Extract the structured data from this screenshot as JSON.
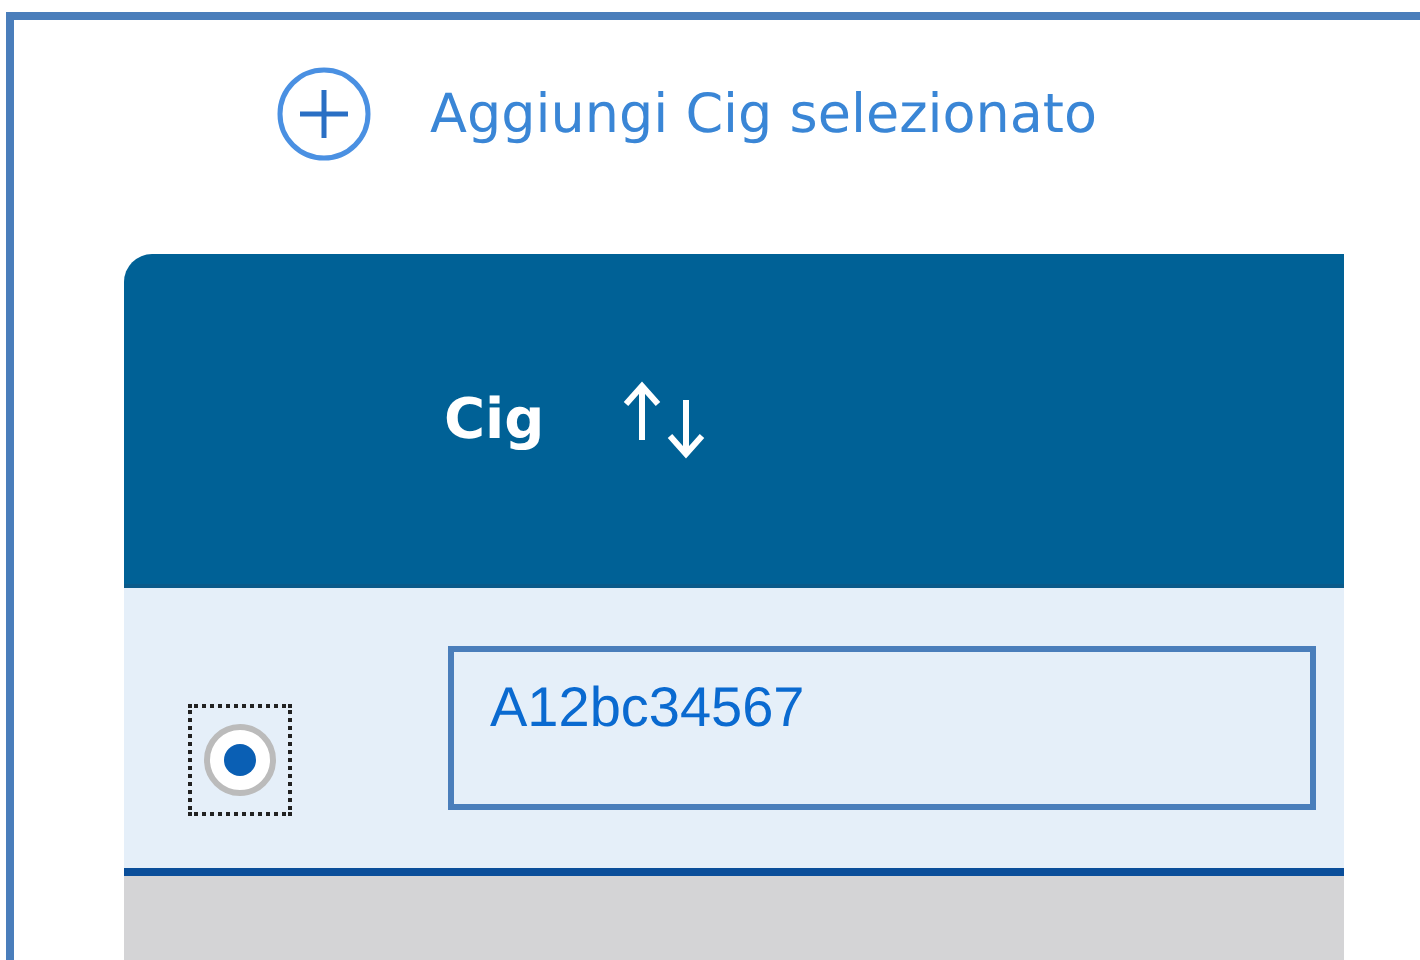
{
  "add_link": {
    "label": "Aggiungi Cig selezionato"
  },
  "table": {
    "columns": [
      {
        "label": "Cig",
        "sortable": true
      }
    ],
    "rows": [
      {
        "selected": true,
        "cig": "A12bc34567"
      }
    ]
  }
}
